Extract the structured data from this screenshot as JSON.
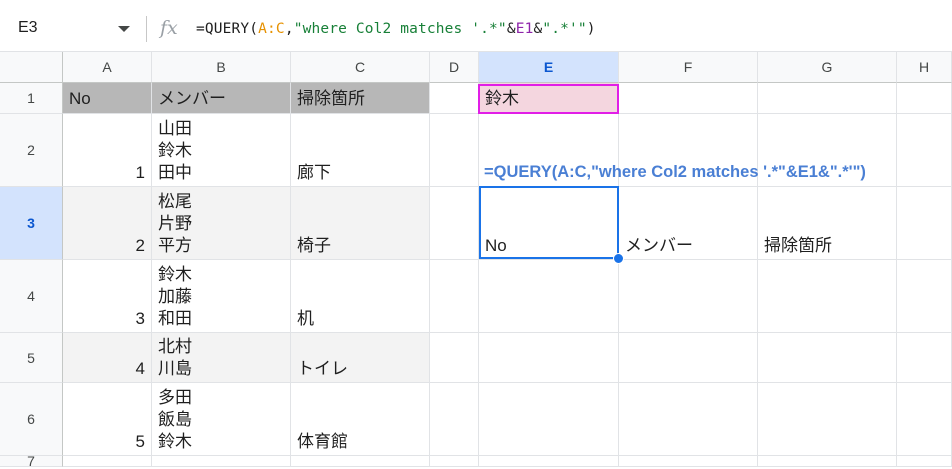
{
  "formula_bar": {
    "name_box": "E3",
    "fx_label": "fx",
    "formula_parts": [
      {
        "text": "=QUERY(",
        "color": "black"
      },
      {
        "text": "A:C",
        "color": "orange"
      },
      {
        "text": ",",
        "color": "black"
      },
      {
        "text": "\"where Col2 matches '.*\"",
        "color": "green"
      },
      {
        "text": "&",
        "color": "black"
      },
      {
        "text": "E1",
        "color": "purple"
      },
      {
        "text": "&",
        "color": "black"
      },
      {
        "text": "\".*'\"",
        "color": "green"
      },
      {
        "text": ")",
        "color": "black"
      }
    ]
  },
  "columns": [
    "A",
    "B",
    "C",
    "D",
    "E",
    "F",
    "G",
    "H"
  ],
  "active_column": "E",
  "rows": [
    "1",
    "2",
    "3",
    "4",
    "5",
    "6",
    "7"
  ],
  "active_row": "3",
  "cells": {
    "A1": "No",
    "B1": "メンバー",
    "C1": "掃除箇所",
    "E1": "鈴木",
    "A2": "1",
    "B2": "山田\n鈴木\n田中",
    "C2": "廊下",
    "A3": "2",
    "B3": "松尾\n片野\n平方",
    "C3": "椅子",
    "A4": "3",
    "B4": "鈴木\n加藤\n和田",
    "C4": "机",
    "A5": "4",
    "B5": "北村\n川島",
    "C5": "トイレ",
    "A6": "5",
    "B6": "多田\n飯島\n鈴木",
    "C6": "体育館",
    "E3": "No",
    "F3": "メンバー",
    "G3": "掃除箇所"
  },
  "overlay_formula": "=QUERY(A:C,\"where Col2 matches '.*\"&E1&\".*'\")",
  "colors": {
    "selection": "#1a73e8",
    "highlight_border": "#e11ee7",
    "highlight_fill": "#f4d6df",
    "header_fill": "#b7b7b7",
    "band_fill": "#f3f3f3",
    "overlay_text": "#4a7fd4"
  }
}
